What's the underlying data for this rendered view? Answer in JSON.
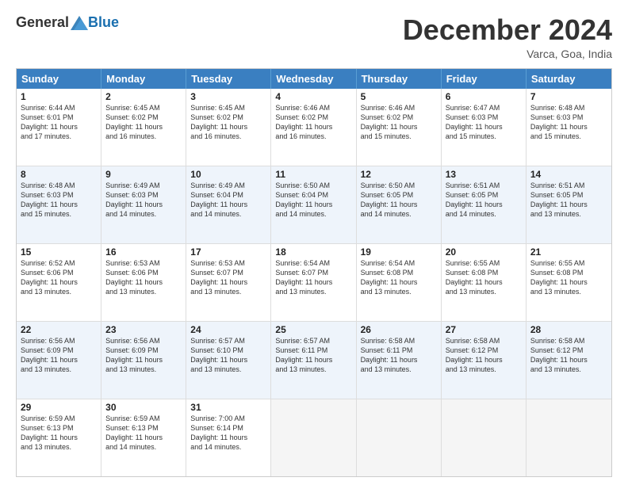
{
  "header": {
    "logo_general": "General",
    "logo_blue": "Blue",
    "month_title": "December 2024",
    "location": "Varca, Goa, India"
  },
  "calendar": {
    "days": [
      "Sunday",
      "Monday",
      "Tuesday",
      "Wednesday",
      "Thursday",
      "Friday",
      "Saturday"
    ],
    "rows": [
      [
        {
          "day": "1",
          "info": "Sunrise: 6:44 AM\nSunset: 6:01 PM\nDaylight: 11 hours\nand 17 minutes."
        },
        {
          "day": "2",
          "info": "Sunrise: 6:45 AM\nSunset: 6:02 PM\nDaylight: 11 hours\nand 16 minutes."
        },
        {
          "day": "3",
          "info": "Sunrise: 6:45 AM\nSunset: 6:02 PM\nDaylight: 11 hours\nand 16 minutes."
        },
        {
          "day": "4",
          "info": "Sunrise: 6:46 AM\nSunset: 6:02 PM\nDaylight: 11 hours\nand 16 minutes."
        },
        {
          "day": "5",
          "info": "Sunrise: 6:46 AM\nSunset: 6:02 PM\nDaylight: 11 hours\nand 15 minutes."
        },
        {
          "day": "6",
          "info": "Sunrise: 6:47 AM\nSunset: 6:03 PM\nDaylight: 11 hours\nand 15 minutes."
        },
        {
          "day": "7",
          "info": "Sunrise: 6:48 AM\nSunset: 6:03 PM\nDaylight: 11 hours\nand 15 minutes."
        }
      ],
      [
        {
          "day": "8",
          "info": "Sunrise: 6:48 AM\nSunset: 6:03 PM\nDaylight: 11 hours\nand 15 minutes."
        },
        {
          "day": "9",
          "info": "Sunrise: 6:49 AM\nSunset: 6:03 PM\nDaylight: 11 hours\nand 14 minutes."
        },
        {
          "day": "10",
          "info": "Sunrise: 6:49 AM\nSunset: 6:04 PM\nDaylight: 11 hours\nand 14 minutes."
        },
        {
          "day": "11",
          "info": "Sunrise: 6:50 AM\nSunset: 6:04 PM\nDaylight: 11 hours\nand 14 minutes."
        },
        {
          "day": "12",
          "info": "Sunrise: 6:50 AM\nSunset: 6:05 PM\nDaylight: 11 hours\nand 14 minutes."
        },
        {
          "day": "13",
          "info": "Sunrise: 6:51 AM\nSunset: 6:05 PM\nDaylight: 11 hours\nand 14 minutes."
        },
        {
          "day": "14",
          "info": "Sunrise: 6:51 AM\nSunset: 6:05 PM\nDaylight: 11 hours\nand 13 minutes."
        }
      ],
      [
        {
          "day": "15",
          "info": "Sunrise: 6:52 AM\nSunset: 6:06 PM\nDaylight: 11 hours\nand 13 minutes."
        },
        {
          "day": "16",
          "info": "Sunrise: 6:53 AM\nSunset: 6:06 PM\nDaylight: 11 hours\nand 13 minutes."
        },
        {
          "day": "17",
          "info": "Sunrise: 6:53 AM\nSunset: 6:07 PM\nDaylight: 11 hours\nand 13 minutes."
        },
        {
          "day": "18",
          "info": "Sunrise: 6:54 AM\nSunset: 6:07 PM\nDaylight: 11 hours\nand 13 minutes."
        },
        {
          "day": "19",
          "info": "Sunrise: 6:54 AM\nSunset: 6:08 PM\nDaylight: 11 hours\nand 13 minutes."
        },
        {
          "day": "20",
          "info": "Sunrise: 6:55 AM\nSunset: 6:08 PM\nDaylight: 11 hours\nand 13 minutes."
        },
        {
          "day": "21",
          "info": "Sunrise: 6:55 AM\nSunset: 6:08 PM\nDaylight: 11 hours\nand 13 minutes."
        }
      ],
      [
        {
          "day": "22",
          "info": "Sunrise: 6:56 AM\nSunset: 6:09 PM\nDaylight: 11 hours\nand 13 minutes."
        },
        {
          "day": "23",
          "info": "Sunrise: 6:56 AM\nSunset: 6:09 PM\nDaylight: 11 hours\nand 13 minutes."
        },
        {
          "day": "24",
          "info": "Sunrise: 6:57 AM\nSunset: 6:10 PM\nDaylight: 11 hours\nand 13 minutes."
        },
        {
          "day": "25",
          "info": "Sunrise: 6:57 AM\nSunset: 6:11 PM\nDaylight: 11 hours\nand 13 minutes."
        },
        {
          "day": "26",
          "info": "Sunrise: 6:58 AM\nSunset: 6:11 PM\nDaylight: 11 hours\nand 13 minutes."
        },
        {
          "day": "27",
          "info": "Sunrise: 6:58 AM\nSunset: 6:12 PM\nDaylight: 11 hours\nand 13 minutes."
        },
        {
          "day": "28",
          "info": "Sunrise: 6:58 AM\nSunset: 6:12 PM\nDaylight: 11 hours\nand 13 minutes."
        }
      ],
      [
        {
          "day": "29",
          "info": "Sunrise: 6:59 AM\nSunset: 6:13 PM\nDaylight: 11 hours\nand 13 minutes."
        },
        {
          "day": "30",
          "info": "Sunrise: 6:59 AM\nSunset: 6:13 PM\nDaylight: 11 hours\nand 14 minutes."
        },
        {
          "day": "31",
          "info": "Sunrise: 7:00 AM\nSunset: 6:14 PM\nDaylight: 11 hours\nand 14 minutes."
        },
        {
          "day": "",
          "info": ""
        },
        {
          "day": "",
          "info": ""
        },
        {
          "day": "",
          "info": ""
        },
        {
          "day": "",
          "info": ""
        }
      ]
    ]
  }
}
